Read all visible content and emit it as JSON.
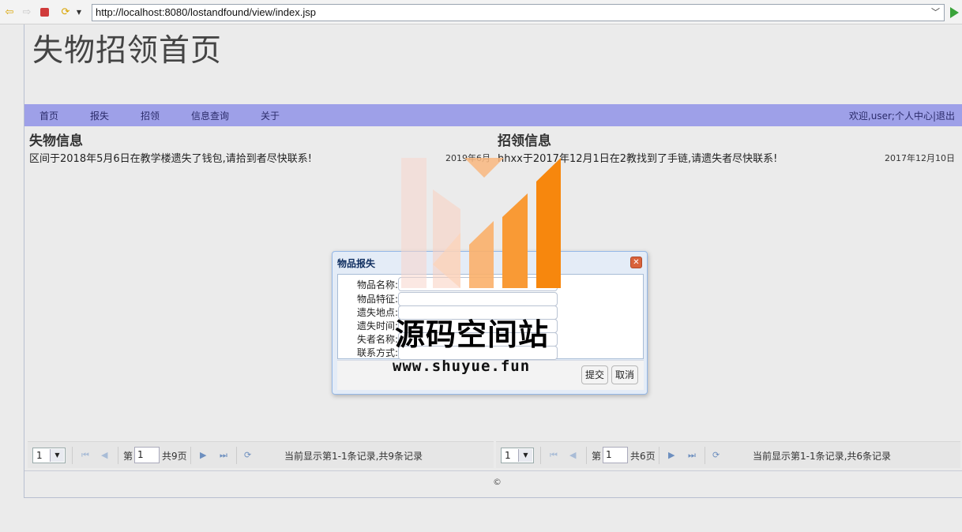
{
  "browser": {
    "url": "http://localhost:8080/lostandfound/view/index.jsp"
  },
  "page": {
    "title": "失物招领首页",
    "copyright": "©"
  },
  "menu": {
    "items": [
      {
        "label": "首页"
      },
      {
        "label": "报失"
      },
      {
        "label": "招领"
      },
      {
        "label": "信息查询"
      },
      {
        "label": "关于"
      }
    ],
    "user_area": "欢迎,user;个人中心|退出"
  },
  "lost": {
    "heading": "失物信息",
    "rows": [
      {
        "text": "区间于2018年5月6日在教学楼遗失了钱包,请拾到者尽快联系!",
        "date": "2019年6月"
      }
    ],
    "pager": {
      "page_size": "1",
      "page_prefix": "第",
      "page": "1",
      "page_total": "共9页",
      "info": "当前显示第1-1条记录,共9条记录"
    }
  },
  "found": {
    "heading": "招领信息",
    "rows": [
      {
        "text": "hhxx于2017年12月1日在2教找到了手链,请遗失者尽快联系!",
        "date": "2017年12月10日"
      }
    ],
    "pager": {
      "page_size": "1",
      "page_prefix": "第",
      "page": "1",
      "page_total": "共6页",
      "info": "当前显示第1-1条记录,共6条记录"
    }
  },
  "dialog": {
    "title": "物品报失",
    "fields": [
      {
        "label": "物品名称:"
      },
      {
        "label": "物品特征:"
      },
      {
        "label": "遗失地点:"
      },
      {
        "label": "遗失时间:"
      },
      {
        "label": "失者名称:"
      },
      {
        "label": "联系方式:"
      }
    ],
    "submit_label": "提交",
    "cancel_label": "取消"
  },
  "watermark": {
    "text": "源码空间站",
    "url": "www.shuyue.fun"
  },
  "colors": {
    "menu_bg": "#9ea0e8",
    "dialog_border": "#95b8e7",
    "watermark_orange": "#f7870d"
  }
}
